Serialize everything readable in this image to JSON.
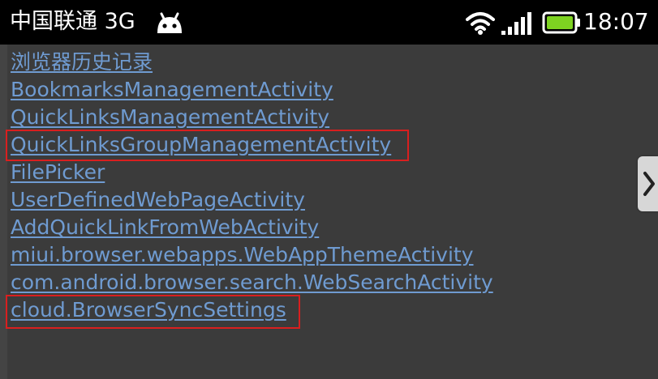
{
  "status_bar": {
    "carrier": "中国联通 3G",
    "time": "18:07",
    "icons": [
      "android-icon",
      "wifi-icon",
      "signal-icon",
      "battery-icon"
    ],
    "battery_color": "#7ed321"
  },
  "activity_links": [
    {
      "label": "浏览器历史记录"
    },
    {
      "label": "BookmarksManagementActivity"
    },
    {
      "label": "QuickLinksManagementActivity"
    },
    {
      "label": "QuickLinksGroupManagementActivity"
    },
    {
      "label": "FilePicker"
    },
    {
      "label": "UserDefinedWebPageActivity"
    },
    {
      "label": "AddQuickLinkFromWebActivity"
    },
    {
      "label": "miui.browser.webapps.WebAppThemeActivity"
    },
    {
      "label": "com.android.browser.search.WebSearchActivity"
    },
    {
      "label": "cloud.BrowserSyncSettings"
    }
  ],
  "highlights": {
    "color": "#d91f1f",
    "items": [
      "QuickLinksGroupManagementActivity",
      "cloud.BrowserSyncSettings"
    ]
  },
  "colors": {
    "background": "#3b3b3b",
    "status_bar_bg": "#000000",
    "link": "#6f9bd1",
    "edge_tab": "#d7d7d7"
  },
  "edge_tab_icon": "chevron-right-icon"
}
